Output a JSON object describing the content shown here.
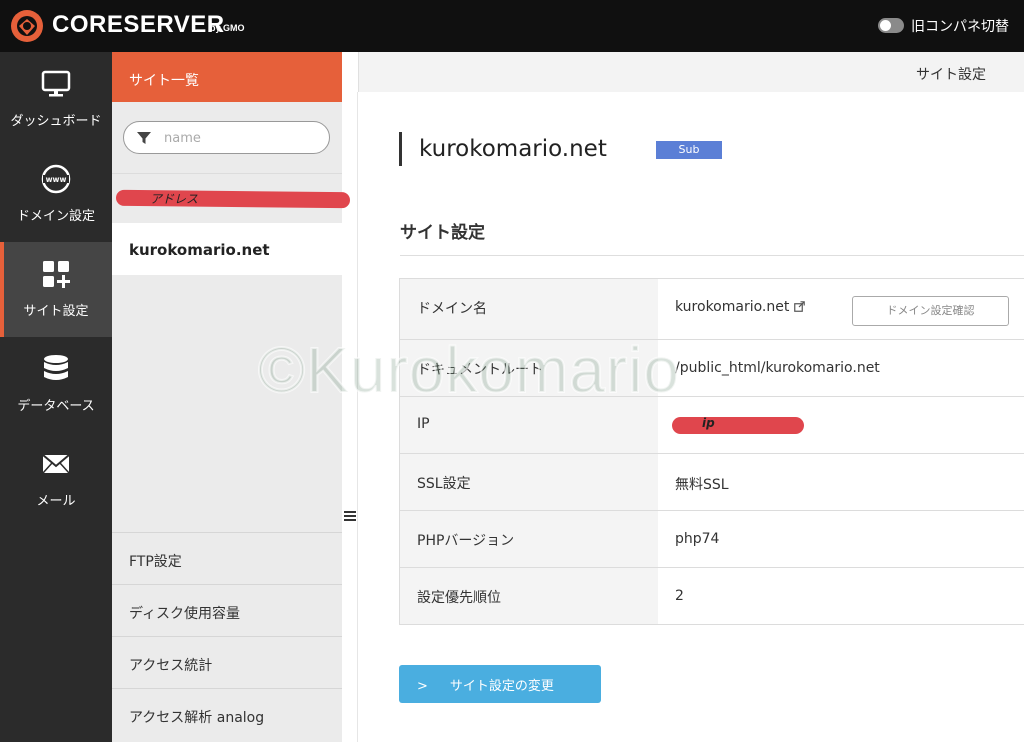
{
  "header": {
    "brand": "CORESERVER",
    "brand_sub": "by GMO",
    "toggle_label": "旧コンパネ切替"
  },
  "nav": {
    "items": [
      {
        "label": "ダッシュボード",
        "icon": "monitor-icon"
      },
      {
        "label": "ドメイン設定",
        "icon": "globe-www-icon"
      },
      {
        "label": "サイト設定",
        "icon": "grid-plus-icon",
        "active": true
      },
      {
        "label": "データベース",
        "icon": "database-icon"
      },
      {
        "label": "メール",
        "icon": "mail-icon"
      }
    ]
  },
  "sidebar": {
    "title": "サイト一覧",
    "search_placeholder": "name",
    "group_label": "アドレス",
    "selected_site": "kurokomario.net",
    "links": [
      "FTP設定",
      "ディスク使用容量",
      "アクセス統計",
      "アクセス解析 analog"
    ]
  },
  "main": {
    "topbar_label": "サイト設定",
    "site_title": "kurokomario.net",
    "badge": "Sub",
    "section_title": "サイト設定",
    "rows": [
      {
        "label": "ドメイン名",
        "value": "kurokomario.net"
      },
      {
        "label": "ドキュメントルート",
        "value": "/public_html/kurokomario.net"
      },
      {
        "label": "IP",
        "value": "ip"
      },
      {
        "label": "SSL設定",
        "value": "無料SSL"
      },
      {
        "label": "PHPバージョン",
        "value": "php74"
      },
      {
        "label": "設定優先順位",
        "value": "2"
      }
    ],
    "domain_check_button": "ドメイン設定確認",
    "change_button": "サイト設定の変更"
  },
  "watermark": "©Kurokomario",
  "colors": {
    "accent": "#e6603a",
    "badge": "#5b7fd6",
    "primary_button": "#4aaee0",
    "header_bg": "#101010",
    "nav_bg": "#2b2b2b"
  }
}
